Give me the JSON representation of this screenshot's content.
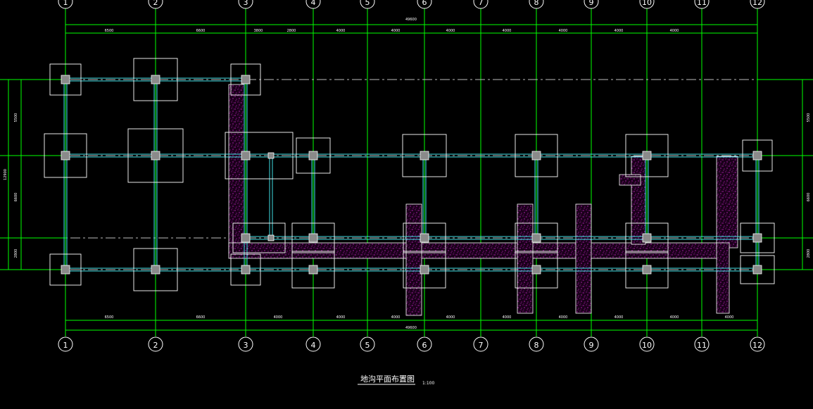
{
  "drawing": {
    "title": "地沟平面布置图",
    "scale": "1:100",
    "axes": [
      "1",
      "2",
      "3",
      "4",
      "5",
      "6",
      "7",
      "8",
      "9",
      "10",
      "11",
      "12"
    ],
    "top_total": "49600",
    "bottom_total": "49600",
    "top_spans": [
      "6500",
      "6600",
      "3800",
      "2800",
      "4000",
      "4000",
      "4000",
      "4000",
      "4000",
      "4000",
      "4000"
    ],
    "bottom_spans": [
      "6500",
      "6600",
      "4000",
      "4000",
      "4000",
      "4000",
      "4000",
      "4000",
      "4000",
      "4000",
      "4000"
    ],
    "left_total": "12900",
    "left_spans": [
      "5500",
      "6600",
      "2800"
    ],
    "right_spans": [
      "5500",
      "6600",
      "2800"
    ]
  },
  "colors": {
    "background": "#000000",
    "grid": "#00ff00",
    "beam": "#3fe0e6",
    "trench_fill": "#ff00ff",
    "outline": "#ffffff"
  }
}
